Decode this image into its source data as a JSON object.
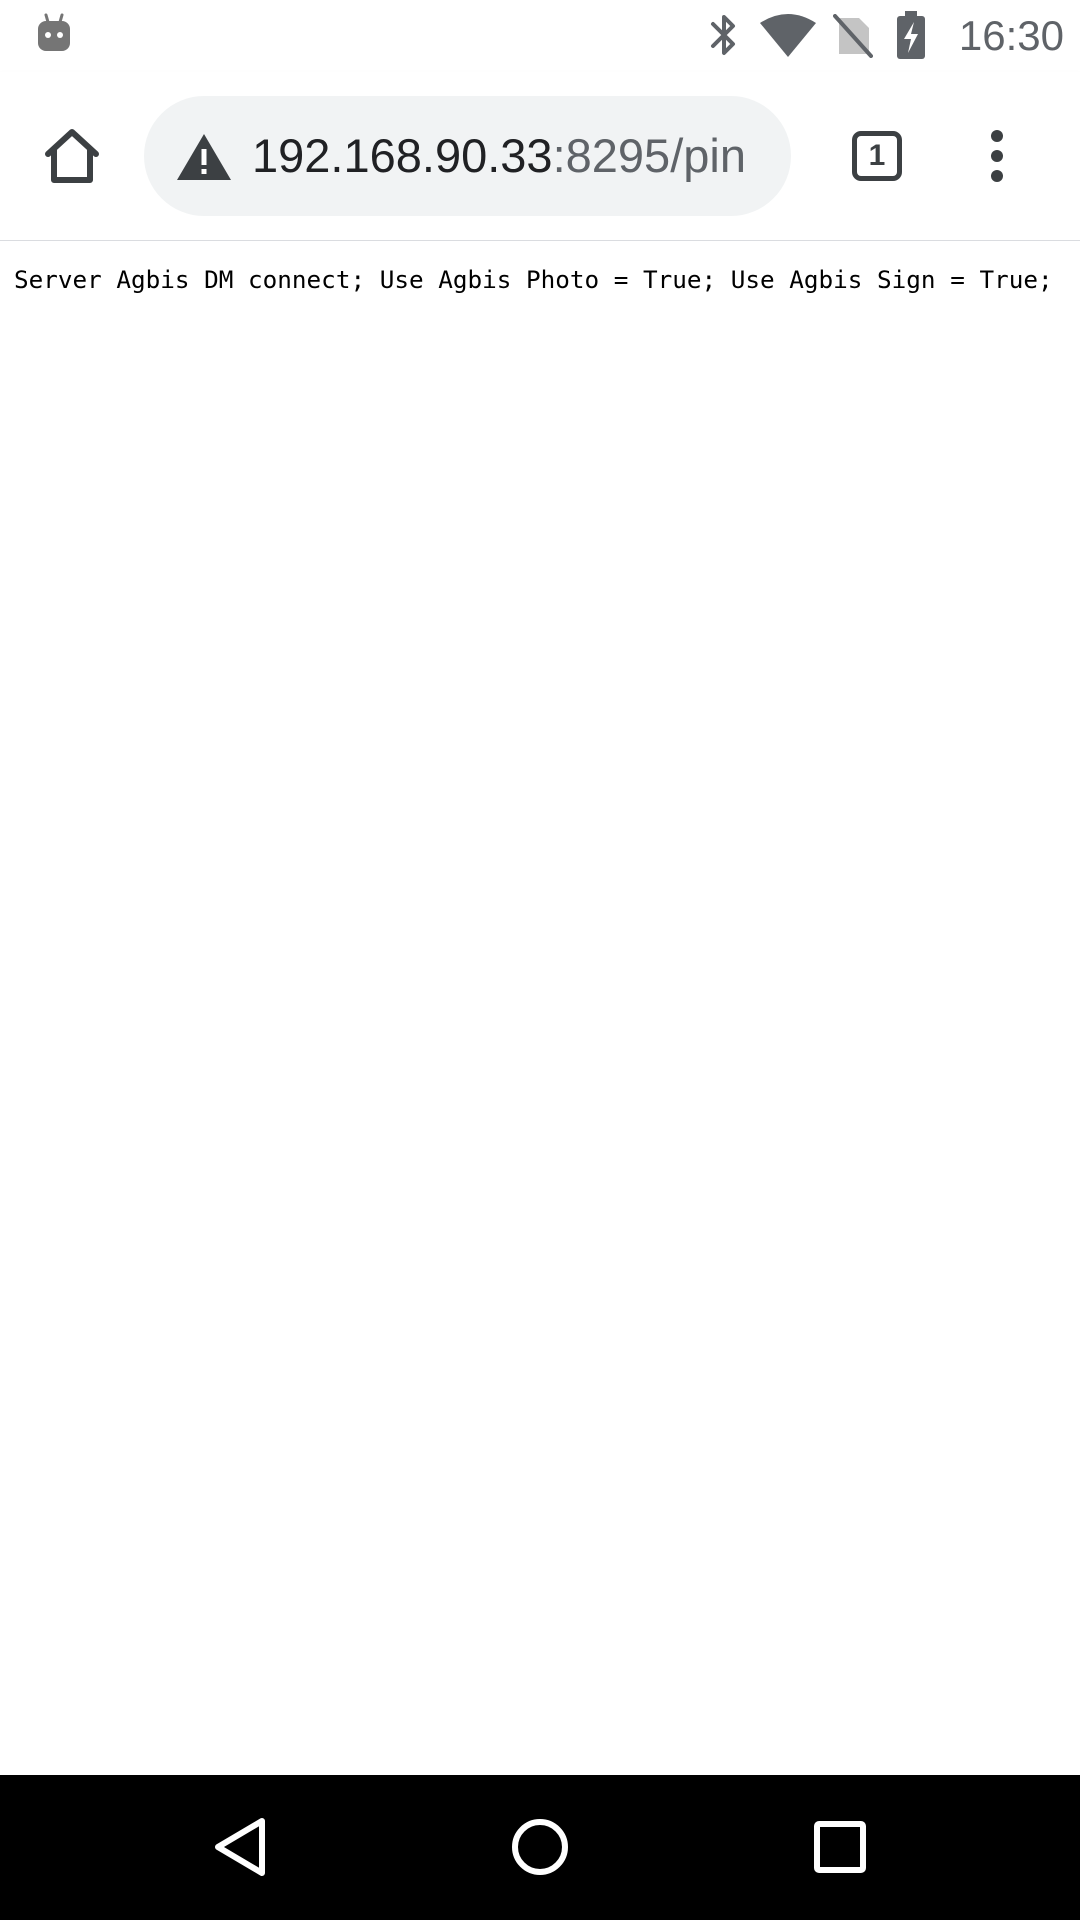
{
  "status_bar": {
    "time": "16:30",
    "icons": [
      "android-notification-icon",
      "bluetooth-icon",
      "wifi-icon",
      "no-sim-icon",
      "battery-charging-icon"
    ]
  },
  "browser": {
    "url_host": "192.168.90.33",
    "url_path": ":8295/pin",
    "tab_count": "1",
    "icons": [
      "home-icon",
      "warning-icon",
      "tab-switcher-icon",
      "more-vert-icon"
    ]
  },
  "page": {
    "text": "Server Agbis DM connect; Use Agbis Photo = True; Use Agbis Sign = True;"
  },
  "nav_bar": {
    "icons": [
      "back-icon",
      "home-circle-icon",
      "recents-icon"
    ]
  },
  "colors": {
    "omnibox_bg": "#f1f3f4",
    "icon_dark": "#3c4043",
    "status_gray": "#5f6368",
    "nav_bg": "#000000"
  }
}
